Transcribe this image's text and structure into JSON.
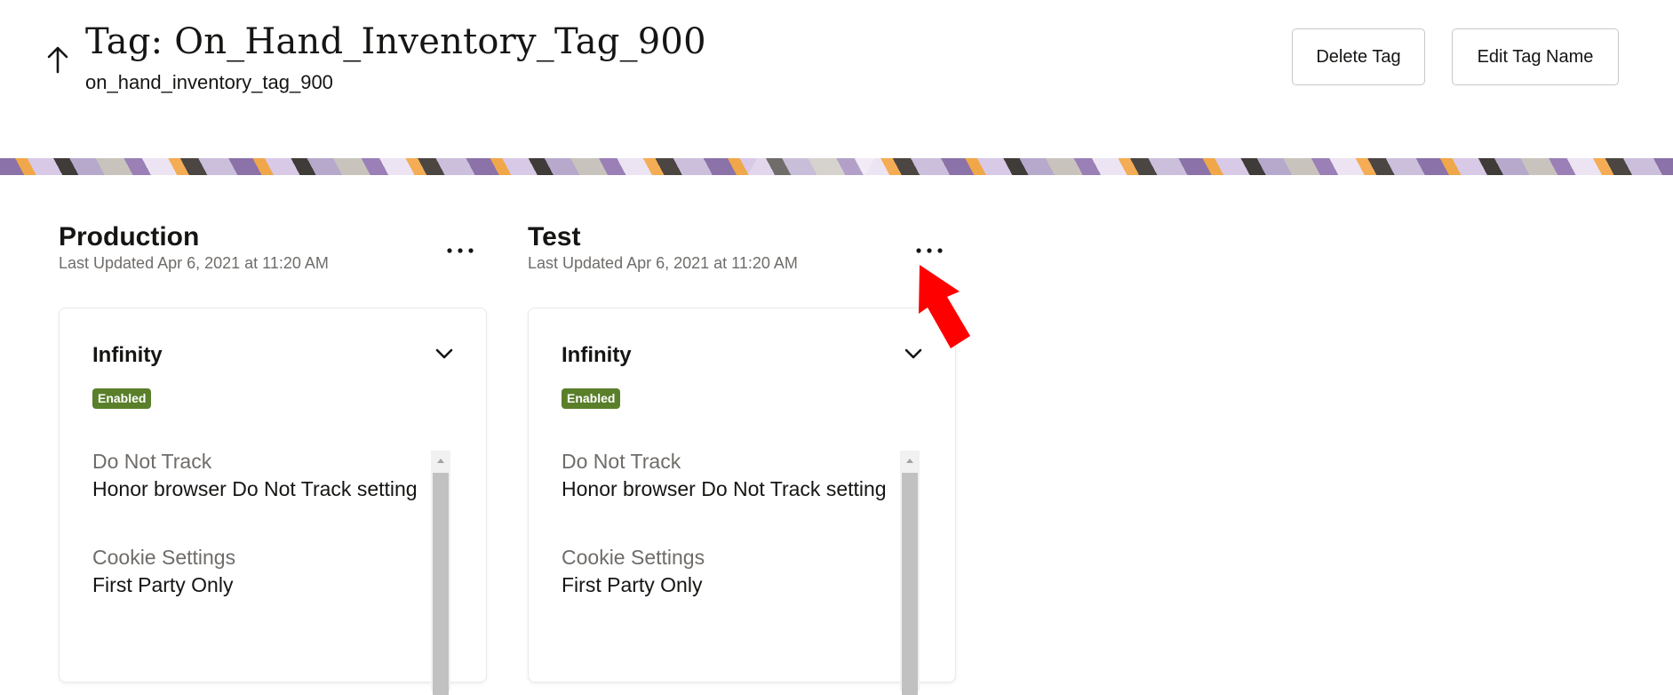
{
  "header": {
    "title": "Tag: On_Hand_Inventory_Tag_900",
    "subtitle": "on_hand_inventory_tag_900",
    "back_icon": "arrow-up-icon",
    "delete_label": "Delete Tag",
    "edit_label": "Edit Tag Name"
  },
  "environments": [
    {
      "name": "Production",
      "last_updated": "Last Updated Apr 6, 2021 at 11:20 AM",
      "card": {
        "title": "Infinity",
        "status": "Enabled",
        "settings": [
          {
            "label": "Do Not Track",
            "value": "Honor browser Do Not Track setting"
          },
          {
            "label": "Cookie Settings",
            "value": "First Party Only"
          }
        ]
      }
    },
    {
      "name": "Test",
      "last_updated": "Last Updated Apr 6, 2021 at 11:20 AM",
      "card": {
        "title": "Infinity",
        "status": "Enabled",
        "settings": [
          {
            "label": "Do Not Track",
            "value": "Honor browser Do Not Track setting"
          },
          {
            "label": "Cookie Settings",
            "value": "First Party Only"
          }
        ]
      }
    }
  ],
  "colors": {
    "status_enabled": "#5a7f2b",
    "annotation": "#ff0000",
    "muted_text": "#6f6c69"
  },
  "icons": {
    "more": "more-horizontal-icon",
    "expand": "chevron-down-icon",
    "annotation": "red-arrow-icon"
  }
}
